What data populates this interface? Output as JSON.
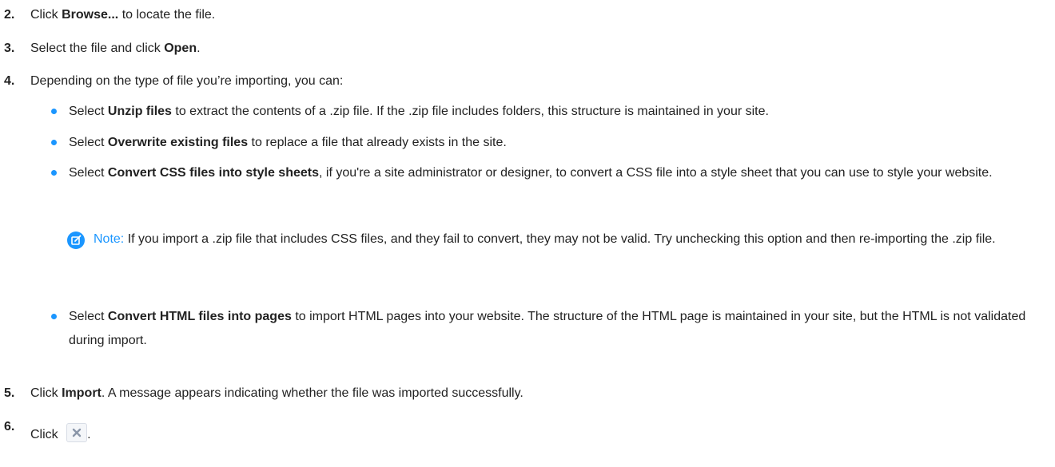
{
  "steps": [
    {
      "num": "2.",
      "pre": "Click ",
      "bold": "Browse...",
      "post": " to locate the file."
    },
    {
      "num": "3.",
      "pre": "Select the file and click ",
      "bold": "Open",
      "post": "."
    },
    {
      "num": "4.",
      "text": "Depending on the type of file you’re importing, you can:"
    },
    {
      "num": "5.",
      "pre": "Click ",
      "bold": "Import",
      "post": ". A message appears indicating whether the file was imported successfully."
    },
    {
      "num": "6.",
      "pre": "Click ",
      "post": "."
    }
  ],
  "options": [
    {
      "pre": "Select ",
      "bold": "Unzip files",
      "post": " to extract the contents of a .zip file. If the .zip file includes folders, this structure is maintained in your site."
    },
    {
      "pre": "Select ",
      "bold": "Overwrite existing files",
      "post": " to replace a file that already exists in the site."
    },
    {
      "pre": "Select ",
      "bold": "Convert CSS files into style sheets",
      "post": ", if you're a site administrator or designer, to convert a CSS file into a style sheet that you can use to style your website."
    },
    {
      "pre": "Select ",
      "bold": "Convert HTML files into pages",
      "post": " to import HTML pages into your website. The structure of the HTML page is maintained in your site, but the HTML is not validated during import."
    }
  ],
  "note": {
    "label": "Note:",
    "text": " If you import a .zip file that includes CSS files, and they fail to convert, they may not be valid. Try unchecking this option and then re-importing the .zip file."
  },
  "colors": {
    "accent": "#1b96ff",
    "text": "#222222"
  },
  "icons": {
    "note": "note-edit-icon",
    "close": "close-icon"
  }
}
